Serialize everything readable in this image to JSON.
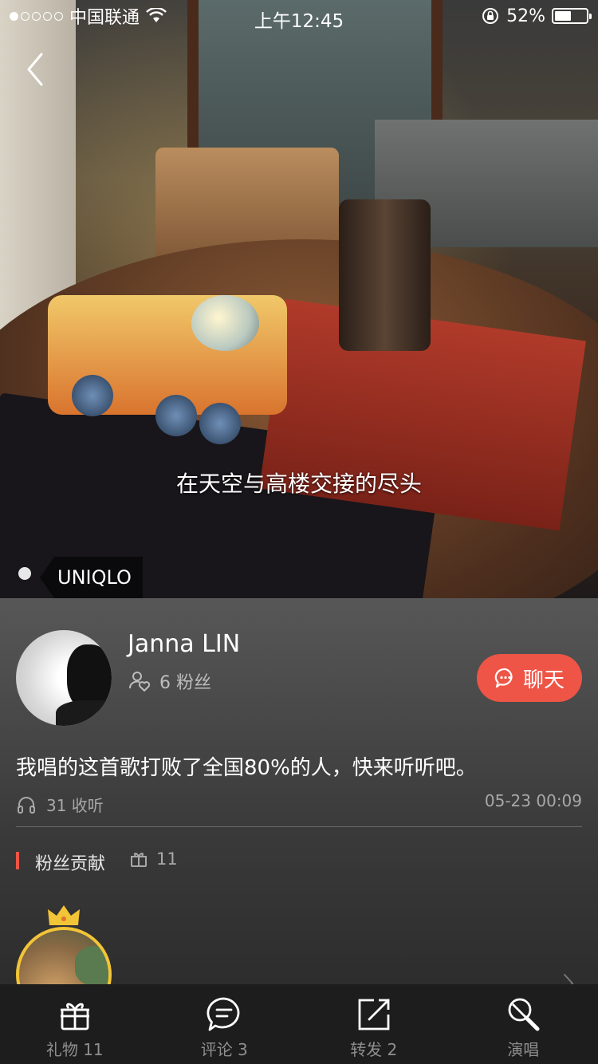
{
  "status_bar": {
    "carrier": "中国联通",
    "time": "上午12:45",
    "battery": "52%",
    "battery_level": 0.52
  },
  "hero": {
    "lyric": "在天空与高楼交接的尽头",
    "brand_tag": "UNIQLO"
  },
  "user": {
    "name": "Janna LIN",
    "fans": "6 粉丝",
    "chat_label": "聊天"
  },
  "post": {
    "description": "我唱的这首歌打败了全国80%的人，快来听听吧。",
    "listens": "31 收听",
    "timestamp": "05-23 00:09"
  },
  "contributions": {
    "title": "粉丝贡献",
    "gift_count": "11"
  },
  "tabs": [
    {
      "label": "礼物 11",
      "icon": "gift-icon"
    },
    {
      "label": "评论 3",
      "icon": "comment-icon"
    },
    {
      "label": "转发 2",
      "icon": "share-icon"
    },
    {
      "label": "演唱",
      "icon": "microphone-icon"
    }
  ],
  "colors": {
    "accent": "#ee5546",
    "crown": "#f2c437",
    "tabbar": "#1d1d1d"
  }
}
